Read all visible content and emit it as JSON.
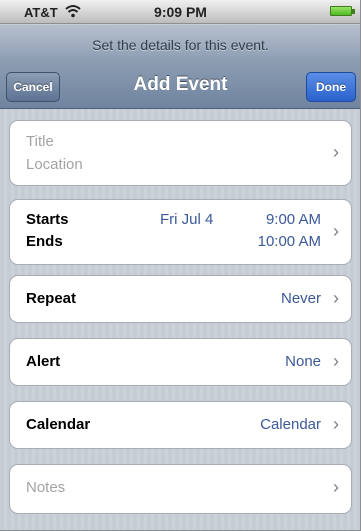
{
  "status_bar": {
    "carrier": "AT&T",
    "time": "9:09 PM"
  },
  "nav": {
    "prompt": "Set the details for this event.",
    "title": "Add Event",
    "cancel_label": "Cancel",
    "done_label": "Done"
  },
  "form": {
    "title_placeholder": "Title",
    "location_placeholder": "Location",
    "starts_label": "Starts",
    "ends_label": "Ends",
    "start_date": "Fri Jul 4",
    "start_time": "9:00 AM",
    "end_time": "10:00 AM",
    "repeat_label": "Repeat",
    "repeat_value": "Never",
    "alert_label": "Alert",
    "alert_value": "None",
    "calendar_label": "Calendar",
    "calendar_value": "Calendar",
    "notes_placeholder": "Notes"
  },
  "icons": {
    "chevron": "chevron-right-icon",
    "wifi": "wifi-icon",
    "battery": "battery-icon",
    "signal": "signal-icon"
  },
  "colors": {
    "value_text": "#3b5998",
    "placeholder_text": "#a3a3a3",
    "done_button": "#2a62cc",
    "nav_bar": "#8b9cb1"
  }
}
